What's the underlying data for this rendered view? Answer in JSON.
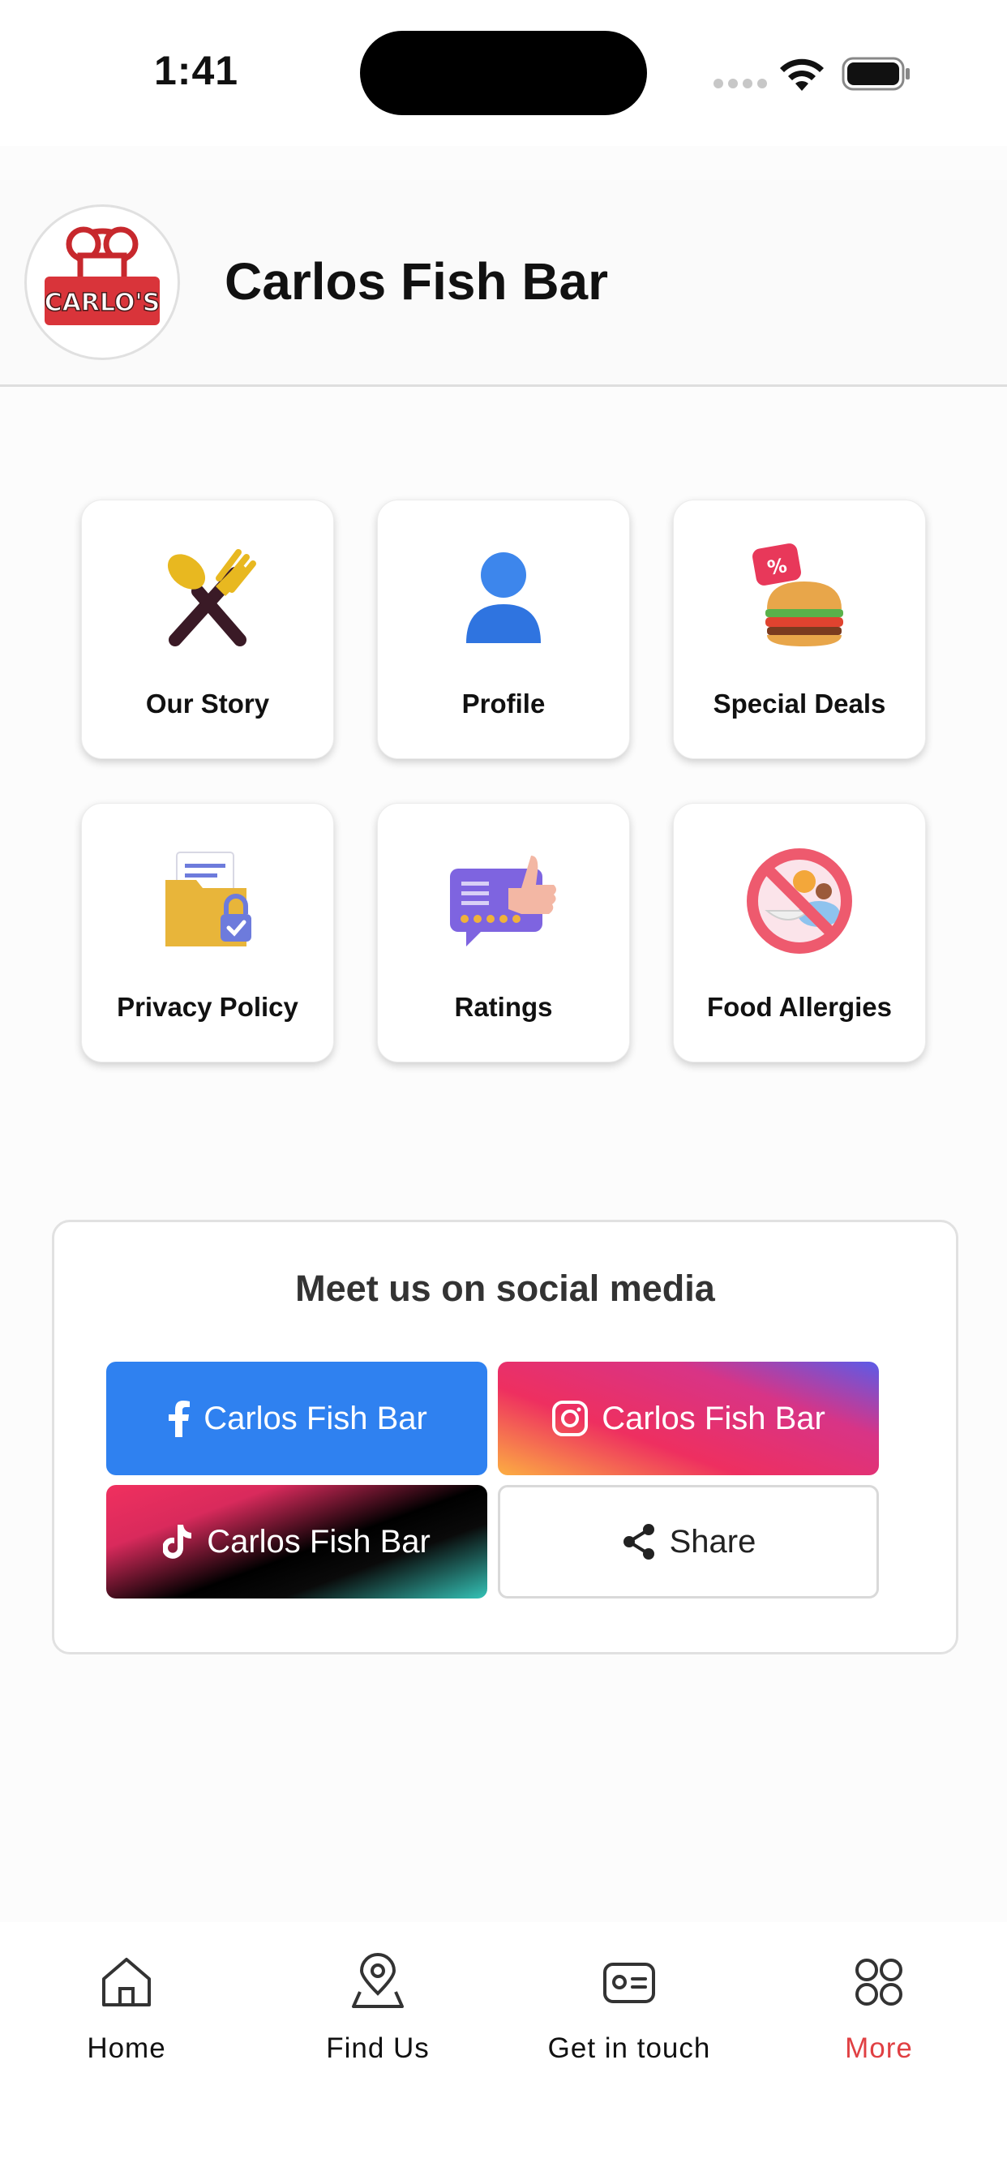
{
  "status_bar": {
    "time": "1:41"
  },
  "header": {
    "title": "Carlos Fish Bar",
    "logo_text": "CARLO'S"
  },
  "tiles": [
    {
      "label": "Our Story",
      "icon": "fork-spoon-icon"
    },
    {
      "label": "Profile",
      "icon": "person-icon"
    },
    {
      "label": "Special Deals",
      "icon": "burger-discount-icon"
    },
    {
      "label": "Privacy Policy",
      "icon": "folder-lock-icon"
    },
    {
      "label": "Ratings",
      "icon": "rating-thumbs-up-icon"
    },
    {
      "label": "Food Allergies",
      "icon": "no-allergen-icon"
    }
  ],
  "social": {
    "title": "Meet us on social media",
    "facebook_label": "Carlos Fish Bar",
    "instagram_label": "Carlos Fish Bar",
    "tiktok_label": "Carlos Fish Bar",
    "share_label": "Share"
  },
  "tabbar": {
    "items": [
      {
        "label": "Home",
        "icon": "home-icon"
      },
      {
        "label": "Find Us",
        "icon": "location-pin-icon"
      },
      {
        "label": "Get in touch",
        "icon": "contact-card-icon"
      },
      {
        "label": "More",
        "icon": "grid-icon",
        "active": true
      }
    ]
  },
  "colors": {
    "accent": "#e04043",
    "facebook": "#2f81f0",
    "background": "#fcfcfc"
  }
}
